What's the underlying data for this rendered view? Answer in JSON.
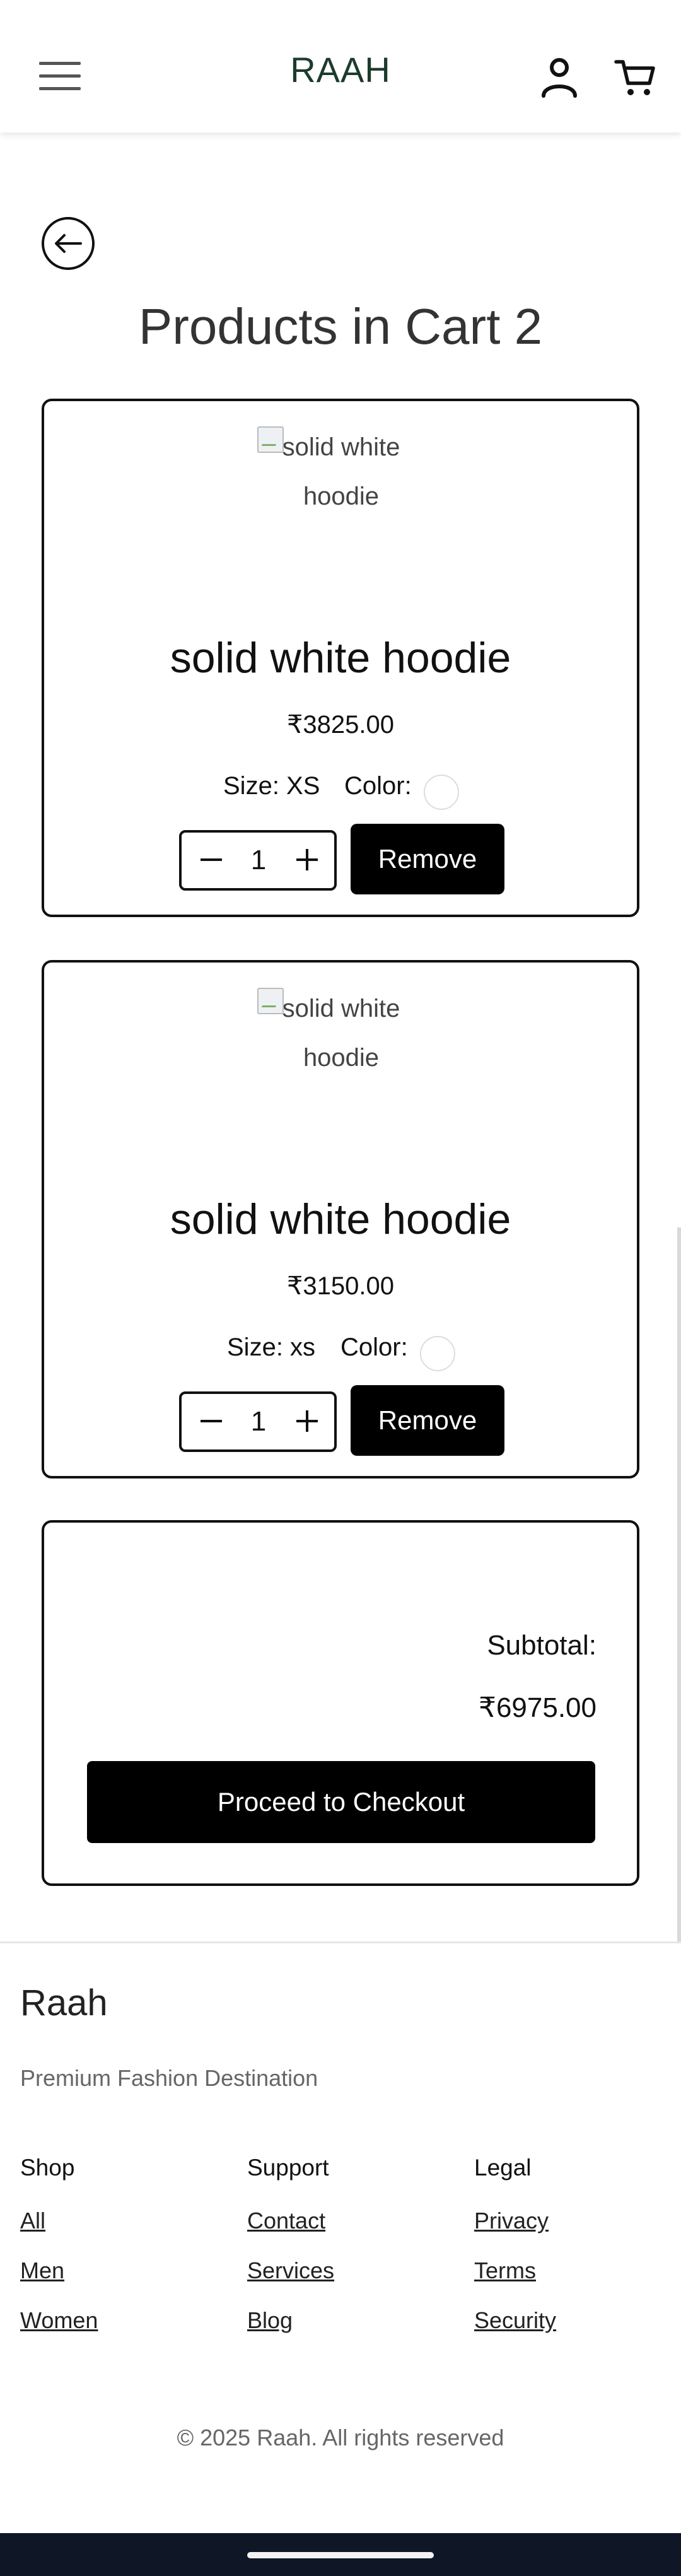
{
  "header": {
    "title": "RAAH",
    "menu_icon": "hamburger-icon",
    "account_icon": "user-icon",
    "cart_icon": "cart-icon"
  },
  "back_icon": "arrow-left-icon",
  "page_title": "Products in Cart 2",
  "cart_items": [
    {
      "image_alt": "solid white hoodie",
      "name": "solid white hoodie",
      "price": "₹3825.00",
      "size_text": "Size: XS",
      "color_label": "Color:",
      "quantity": "1",
      "remove_label": "Remove"
    },
    {
      "image_alt": "solid white hoodie",
      "name": "solid white hoodie",
      "price": "₹3150.00",
      "size_text": "Size: xs",
      "color_label": "Color:",
      "quantity": "1",
      "remove_label": "Remove"
    }
  ],
  "summary": {
    "subtotal_label": "Subtotal:",
    "subtotal_value": "₹6975.00",
    "checkout_label": "Proceed to Checkout"
  },
  "footer": {
    "brand": "Raah",
    "tagline": "Premium Fashion Destination",
    "columns": [
      {
        "heading": "Shop",
        "links": [
          "All",
          "Men",
          "Women"
        ]
      },
      {
        "heading": "Support",
        "links": [
          "Contact",
          "Services",
          "Blog"
        ]
      },
      {
        "heading": "Legal",
        "links": [
          "Privacy",
          "Terms",
          "Security"
        ]
      }
    ],
    "copyright": "© 2025 Raah. All rights reserved"
  },
  "colors": {
    "brand_text": "#1d3b2c",
    "button_bg": "#000000",
    "button_text": "#ffffff",
    "navbar_bg": "#0f1626"
  }
}
